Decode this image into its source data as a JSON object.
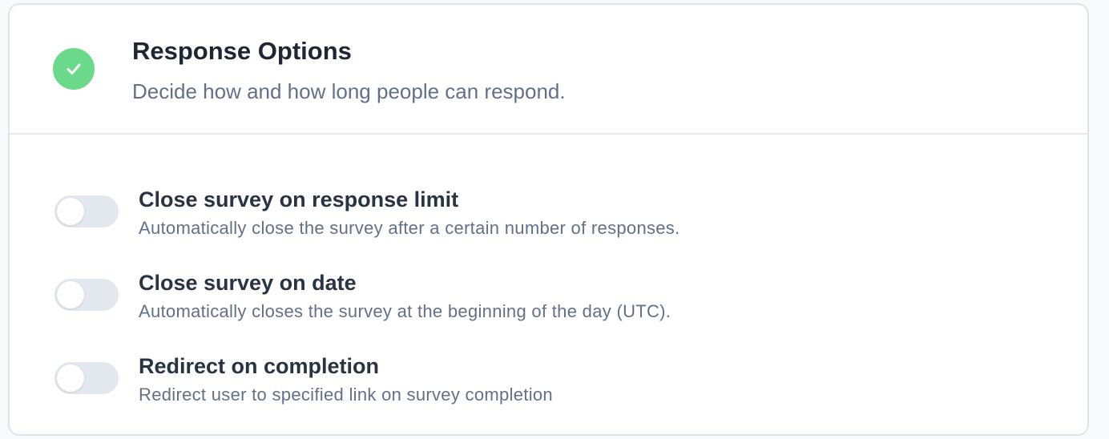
{
  "header": {
    "title": "Response Options",
    "description": "Decide how and how long people can respond.",
    "status_icon": "check-circle-icon",
    "status_color": "#6ad98a"
  },
  "options": [
    {
      "title": "Close survey on response limit",
      "description": "Automatically close the survey after a certain number of responses.",
      "enabled": false
    },
    {
      "title": "Close survey on date",
      "description": "Automatically closes the survey at the beginning of the day (UTC).",
      "enabled": false
    },
    {
      "title": "Redirect on completion",
      "description": "Redirect user to specified link on survey completion",
      "enabled": false
    }
  ]
}
